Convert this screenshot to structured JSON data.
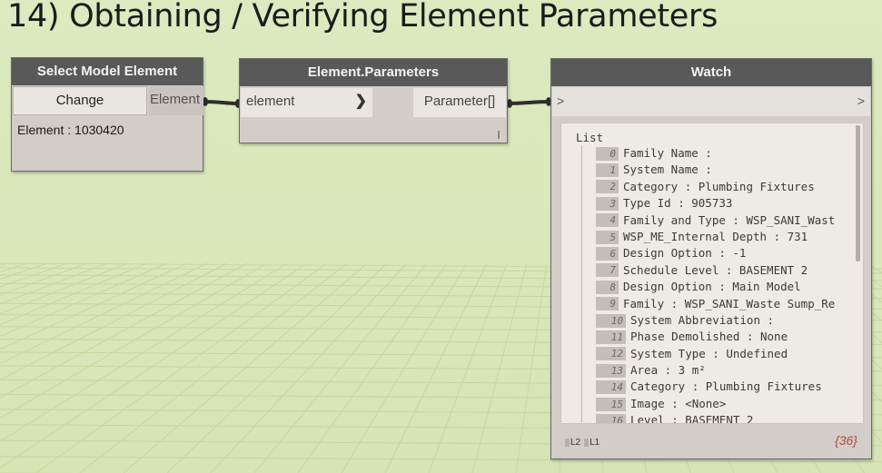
{
  "slide": {
    "title": "14) Obtaining / Verifying Element Parameters"
  },
  "colors": {
    "background": "#dbe8bd",
    "node_header": "#595959",
    "node_body": "#d2cdc8",
    "wire": "#2e2e2e",
    "count_text": "#b1473c"
  },
  "select_node": {
    "title": "Select Model Element",
    "change_label": "Change",
    "output_label": "Element",
    "value": "Element : 1030420"
  },
  "params_node": {
    "title": "Element.Parameters",
    "input_label": "element",
    "input_icon": "chevron-right-icon",
    "output_label": "Parameter[]"
  },
  "watch_node": {
    "title": "Watch",
    "input_label": ">",
    "output_label": ">",
    "list_label": "List",
    "items": [
      {
        "index": "0",
        "text": "Family Name :"
      },
      {
        "index": "1",
        "text": "System Name :"
      },
      {
        "index": "2",
        "text": "Category : Plumbing Fixtures"
      },
      {
        "index": "3",
        "text": "Type Id : 905733"
      },
      {
        "index": "4",
        "text": "Family and Type : WSP_SANI_Wast"
      },
      {
        "index": "5",
        "text": "WSP_ME_Internal Depth : 731"
      },
      {
        "index": "6",
        "text": "Design Option : -1"
      },
      {
        "index": "7",
        "text": "Schedule Level : BASEMENT 2"
      },
      {
        "index": "8",
        "text": "Design Option : Main Model"
      },
      {
        "index": "9",
        "text": "Family : WSP_SANI_Waste Sump_Re"
      },
      {
        "index": "10",
        "text": "System Abbreviation :"
      },
      {
        "index": "11",
        "text": "Phase Demolished : None"
      },
      {
        "index": "12",
        "text": "System Type : Undefined"
      },
      {
        "index": "13",
        "text": "Area : 3 m²"
      },
      {
        "index": "14",
        "text": "Category : Plumbing Fixtures"
      },
      {
        "index": "15",
        "text": "Image : <None>"
      },
      {
        "index": "16",
        "text": "Level : BASEMENT 2"
      }
    ],
    "levels": [
      "L2",
      "L1"
    ],
    "count": "{36}"
  }
}
